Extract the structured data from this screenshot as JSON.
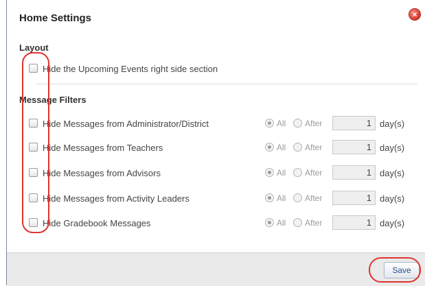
{
  "dialog": {
    "title": "Home Settings",
    "close_icon": "close-icon"
  },
  "layout_section": {
    "title": "Layout",
    "items": [
      {
        "label": "Hide the Upcoming Events right side section",
        "checked": false
      }
    ]
  },
  "message_filters": {
    "title": "Message Filters",
    "items": [
      {
        "label": "Hide Messages from Administrator/District",
        "checked": false,
        "all_label": "All",
        "after_label": "After",
        "selected": "All",
        "days": "1",
        "unit": "day(s)"
      },
      {
        "label": "Hide Messages from Teachers",
        "checked": false,
        "all_label": "All",
        "after_label": "After",
        "selected": "All",
        "days": "1",
        "unit": "day(s)"
      },
      {
        "label": "Hide Messages from Advisors",
        "checked": false,
        "all_label": "All",
        "after_label": "After",
        "selected": "All",
        "days": "1",
        "unit": "day(s)"
      },
      {
        "label": "Hide Messages from Activity Leaders",
        "checked": false,
        "all_label": "All",
        "after_label": "After",
        "selected": "All",
        "days": "1",
        "unit": "day(s)"
      },
      {
        "label": "Hide Gradebook Messages",
        "checked": false,
        "all_label": "All",
        "after_label": "After",
        "selected": "All",
        "days": "1",
        "unit": "day(s)"
      }
    ]
  },
  "footer": {
    "save_label": "Save"
  },
  "colors": {
    "annotation": "#e0332e",
    "close_button": "#d63a2a",
    "save_text": "#2b4f8c"
  }
}
